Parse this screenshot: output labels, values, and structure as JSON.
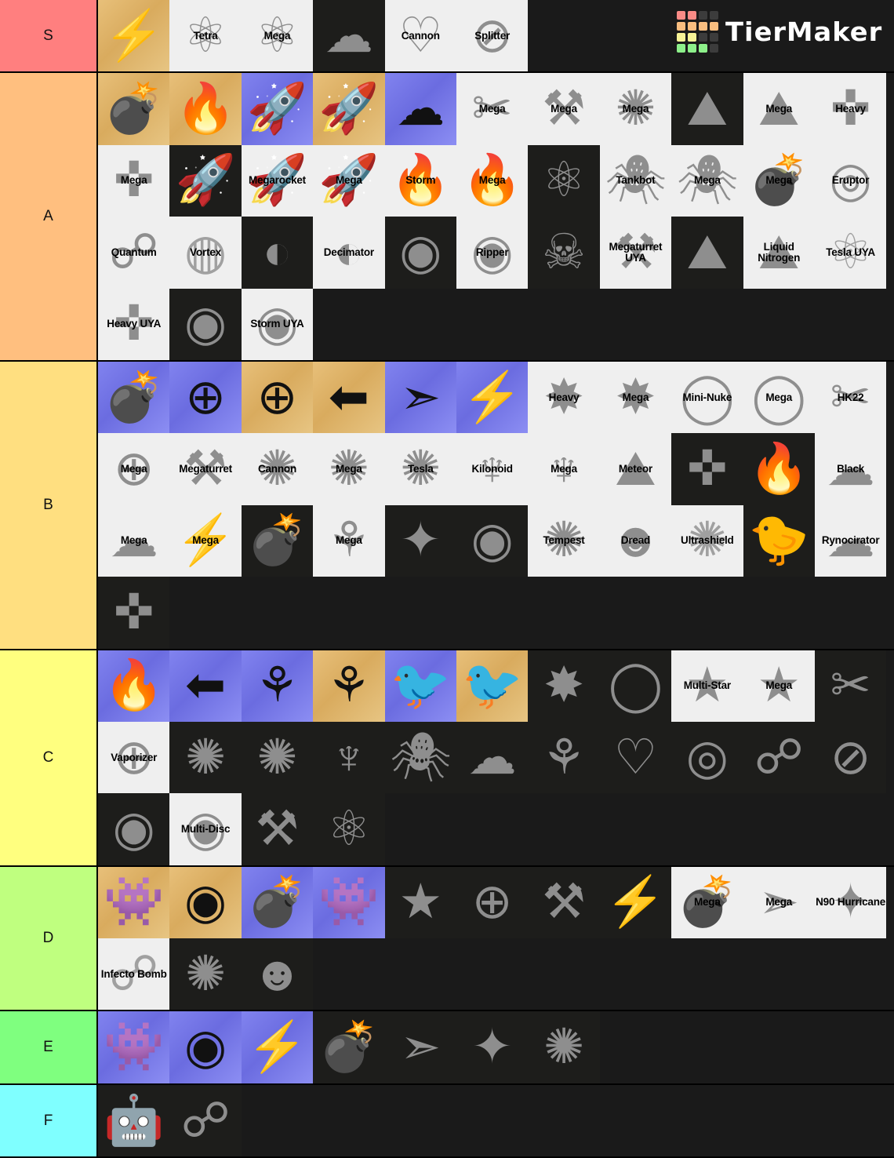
{
  "app": {
    "name": "TierMaker",
    "logo_colors": [
      "#f98b86",
      "#f98b86",
      "#3c3c3c",
      "#3c3c3c",
      "#f8bd7f",
      "#f8bd7f",
      "#f8bd7f",
      "#f8bd7f",
      "#f7f396",
      "#f7f396",
      "#3c3c3c",
      "#3c3c3c",
      "#8df08a",
      "#8df08a",
      "#8df08a",
      "#3c3c3c"
    ]
  },
  "tiers": [
    {
      "label": "S",
      "color": "#ff7f7f",
      "items": [
        {
          "label": "",
          "bg": "gold",
          "ink": "black",
          "glyph": "⚡"
        },
        {
          "label": "Tetra",
          "bg": "white",
          "ink": "gray",
          "glyph": "⚛"
        },
        {
          "label": "Mega",
          "bg": "white",
          "ink": "gray",
          "glyph": "⚛"
        },
        {
          "label": "",
          "bg": "dark",
          "ink": "gray",
          "glyph": "☁"
        },
        {
          "label": "Cannon",
          "bg": "white",
          "ink": "gray",
          "glyph": "♡"
        },
        {
          "label": "Splitter",
          "bg": "white",
          "ink": "gray",
          "glyph": "⊘"
        }
      ]
    },
    {
      "label": "A",
      "color": "#ffbf7f",
      "items": [
        {
          "label": "",
          "bg": "gold",
          "ink": "black",
          "glyph": "💣"
        },
        {
          "label": "",
          "bg": "gold",
          "ink": "black",
          "glyph": "🔥"
        },
        {
          "label": "",
          "bg": "blue",
          "ink": "black",
          "glyph": "🚀"
        },
        {
          "label": "",
          "bg": "gold",
          "ink": "black",
          "glyph": "🚀"
        },
        {
          "label": "",
          "bg": "blue",
          "ink": "black",
          "glyph": "☁"
        },
        {
          "label": "Mega",
          "bg": "white",
          "ink": "gray",
          "glyph": "✂"
        },
        {
          "label": "Mega",
          "bg": "white",
          "ink": "gray",
          "glyph": "⚒"
        },
        {
          "label": "Mega",
          "bg": "white",
          "ink": "gray",
          "glyph": "✺"
        },
        {
          "label": "",
          "bg": "dark",
          "ink": "gray",
          "glyph": "⛰"
        },
        {
          "label": "Mega",
          "bg": "white",
          "ink": "gray",
          "glyph": "⛰"
        },
        {
          "label": "Heavy",
          "bg": "white",
          "ink": "gray",
          "glyph": "✜"
        },
        {
          "label": "Mega",
          "bg": "white",
          "ink": "gray",
          "glyph": "✜"
        },
        {
          "label": "",
          "bg": "dark",
          "ink": "gray",
          "glyph": "🚀"
        },
        {
          "label": "Megarocket",
          "bg": "white",
          "ink": "gray",
          "glyph": "🚀"
        },
        {
          "label": "Mega",
          "bg": "white",
          "ink": "gray",
          "glyph": "🚀"
        },
        {
          "label": "Storm",
          "bg": "white",
          "ink": "gray",
          "glyph": "🔥"
        },
        {
          "label": "Mega",
          "bg": "white",
          "ink": "gray",
          "glyph": "🔥"
        },
        {
          "label": "",
          "bg": "dark",
          "ink": "gray",
          "glyph": "⚛"
        },
        {
          "label": "Tankbot",
          "bg": "white",
          "ink": "gray",
          "glyph": "🕷"
        },
        {
          "label": "Mega",
          "bg": "white",
          "ink": "gray",
          "glyph": "🕷"
        },
        {
          "label": "Mega",
          "bg": "white",
          "ink": "gray",
          "glyph": "💣"
        },
        {
          "label": "Eruptor",
          "bg": "white",
          "ink": "gray",
          "glyph": "◎"
        },
        {
          "label": "Quantum",
          "bg": "white",
          "ink": "gray",
          "glyph": "☍"
        },
        {
          "label": "Vortex",
          "bg": "white",
          "ink": "gray2",
          "glyph": "◍"
        },
        {
          "label": "",
          "bg": "dark",
          "ink": "gray",
          "glyph": "◐"
        },
        {
          "label": "Decimator",
          "bg": "white",
          "ink": "gray",
          "glyph": "◐"
        },
        {
          "label": "",
          "bg": "dark",
          "ink": "gray",
          "glyph": "◉"
        },
        {
          "label": "Ripper",
          "bg": "white",
          "ink": "gray",
          "glyph": "◉"
        },
        {
          "label": "",
          "bg": "dark",
          "ink": "gray",
          "glyph": "☠"
        },
        {
          "label": "Megaturret UYA",
          "bg": "white",
          "ink": "gray",
          "glyph": "⚒"
        },
        {
          "label": "",
          "bg": "dark",
          "ink": "gray",
          "glyph": "⛰"
        },
        {
          "label": "Liquid Nitrogen",
          "bg": "white",
          "ink": "gray",
          "glyph": "⛰"
        },
        {
          "label": "Tesla UYA",
          "bg": "white",
          "ink": "gray2",
          "glyph": "⚛"
        },
        {
          "label": "Heavy UYA",
          "bg": "white",
          "ink": "gray",
          "glyph": "✜"
        },
        {
          "label": "",
          "bg": "dark",
          "ink": "gray",
          "glyph": "◉"
        },
        {
          "label": "Storm UYA",
          "bg": "white",
          "ink": "gray",
          "glyph": "◉"
        }
      ]
    },
    {
      "label": "B",
      "color": "#ffdf80",
      "items": [
        {
          "label": "",
          "bg": "blue",
          "ink": "black",
          "glyph": "💣"
        },
        {
          "label": "",
          "bg": "blue",
          "ink": "black",
          "glyph": "⊕"
        },
        {
          "label": "",
          "bg": "gold",
          "ink": "black",
          "glyph": "⊕"
        },
        {
          "label": "",
          "bg": "gold",
          "ink": "black",
          "glyph": "⬅"
        },
        {
          "label": "",
          "bg": "blue",
          "ink": "black",
          "glyph": "➣"
        },
        {
          "label": "",
          "bg": "blue",
          "ink": "black",
          "glyph": "⚡"
        },
        {
          "label": "Heavy",
          "bg": "white",
          "ink": "gray",
          "glyph": "✸"
        },
        {
          "label": "Mega",
          "bg": "white",
          "ink": "gray",
          "glyph": "✸"
        },
        {
          "label": "Mini-Nuke",
          "bg": "white",
          "ink": "gray",
          "glyph": "◯"
        },
        {
          "label": "Mega",
          "bg": "white",
          "ink": "gray",
          "glyph": "◯"
        },
        {
          "label": "HK22",
          "bg": "white",
          "ink": "gray",
          "glyph": "✂"
        },
        {
          "label": "Mega",
          "bg": "white",
          "ink": "gray",
          "glyph": "⊕"
        },
        {
          "label": "Megaturret",
          "bg": "white",
          "ink": "gray",
          "glyph": "⚒"
        },
        {
          "label": "Cannon",
          "bg": "white",
          "ink": "gray",
          "glyph": "✺"
        },
        {
          "label": "Mega",
          "bg": "white",
          "ink": "gray",
          "glyph": "✺"
        },
        {
          "label": "Tesla",
          "bg": "white",
          "ink": "gray",
          "glyph": "✺"
        },
        {
          "label": "Kilonoid",
          "bg": "white",
          "ink": "gray",
          "glyph": "♆"
        },
        {
          "label": "Mega",
          "bg": "white",
          "ink": "gray",
          "glyph": "♆"
        },
        {
          "label": "Meteor",
          "bg": "white",
          "ink": "gray",
          "glyph": "⛰"
        },
        {
          "label": "",
          "bg": "dark",
          "ink": "gray",
          "glyph": "✜"
        },
        {
          "label": "",
          "bg": "dark",
          "ink": "gray",
          "glyph": "🔥"
        },
        {
          "label": "Black",
          "bg": "white",
          "ink": "gray",
          "glyph": "☁"
        },
        {
          "label": "Mega",
          "bg": "white",
          "ink": "gray",
          "glyph": "☁"
        },
        {
          "label": "Mega",
          "bg": "white",
          "ink": "gray",
          "glyph": "⚡"
        },
        {
          "label": "",
          "bg": "dark",
          "ink": "gray",
          "glyph": "💣"
        },
        {
          "label": "Mega",
          "bg": "white",
          "ink": "gray",
          "glyph": "⚘"
        },
        {
          "label": "",
          "bg": "dark",
          "ink": "gray",
          "glyph": "✦"
        },
        {
          "label": "",
          "bg": "dark",
          "ink": "gray",
          "glyph": "◉"
        },
        {
          "label": "Tempest",
          "bg": "white",
          "ink": "gray",
          "glyph": "✺"
        },
        {
          "label": "Dread",
          "bg": "white",
          "ink": "gray",
          "glyph": "☻"
        },
        {
          "label": "Ultrashield",
          "bg": "white",
          "ink": "gray2",
          "glyph": "✺"
        },
        {
          "label": "",
          "bg": "dark",
          "ink": "gray",
          "glyph": "🐤"
        },
        {
          "label": "Rynocirator",
          "bg": "white",
          "ink": "gray",
          "glyph": "☁"
        },
        {
          "label": "",
          "bg": "dark",
          "ink": "gray",
          "glyph": "✜"
        }
      ]
    },
    {
      "label": "C",
      "color": "#ffff7f",
      "items": [
        {
          "label": "",
          "bg": "blue",
          "ink": "black",
          "glyph": "🔥"
        },
        {
          "label": "",
          "bg": "blue",
          "ink": "black",
          "glyph": "⬅"
        },
        {
          "label": "",
          "bg": "blue",
          "ink": "black",
          "glyph": "⚘"
        },
        {
          "label": "",
          "bg": "gold",
          "ink": "black",
          "glyph": "⚘"
        },
        {
          "label": "",
          "bg": "blue",
          "ink": "black",
          "glyph": "🐦"
        },
        {
          "label": "",
          "bg": "gold",
          "ink": "black",
          "glyph": "🐦"
        },
        {
          "label": "",
          "bg": "dark",
          "ink": "gray",
          "glyph": "✸"
        },
        {
          "label": "",
          "bg": "dark",
          "ink": "gray",
          "glyph": "◯"
        },
        {
          "label": "Multi-Star",
          "bg": "white",
          "ink": "gray",
          "glyph": "★"
        },
        {
          "label": "Mega",
          "bg": "white",
          "ink": "gray",
          "glyph": "★"
        },
        {
          "label": "",
          "bg": "dark",
          "ink": "gray",
          "glyph": "✂"
        },
        {
          "label": "Vaporizer",
          "bg": "white",
          "ink": "gray",
          "glyph": "⊕"
        },
        {
          "label": "",
          "bg": "dark",
          "ink": "gray",
          "glyph": "✺"
        },
        {
          "label": "",
          "bg": "dark",
          "ink": "gray",
          "glyph": "✺"
        },
        {
          "label": "",
          "bg": "dark",
          "ink": "gray",
          "glyph": "♆"
        },
        {
          "label": "",
          "bg": "dark",
          "ink": "gray",
          "glyph": "🕷"
        },
        {
          "label": "",
          "bg": "dark",
          "ink": "gray",
          "glyph": "☁"
        },
        {
          "label": "",
          "bg": "dark",
          "ink": "gray",
          "glyph": "⚘"
        },
        {
          "label": "",
          "bg": "dark",
          "ink": "gray",
          "glyph": "♡"
        },
        {
          "label": "",
          "bg": "dark",
          "ink": "gray",
          "glyph": "◎"
        },
        {
          "label": "",
          "bg": "dark",
          "ink": "gray",
          "glyph": "☍"
        },
        {
          "label": "",
          "bg": "dark",
          "ink": "gray",
          "glyph": "⊘"
        },
        {
          "label": "",
          "bg": "dark",
          "ink": "gray",
          "glyph": "◉"
        },
        {
          "label": "Multi-Disc",
          "bg": "white",
          "ink": "gray",
          "glyph": "◉"
        },
        {
          "label": "",
          "bg": "dark",
          "ink": "gray",
          "glyph": "⚒"
        },
        {
          "label": "",
          "bg": "dark",
          "ink": "gray",
          "glyph": "⚛"
        }
      ]
    },
    {
      "label": "D",
      "color": "#bfff7f",
      "items": [
        {
          "label": "",
          "bg": "gold",
          "ink": "black",
          "glyph": "👾"
        },
        {
          "label": "",
          "bg": "gold",
          "ink": "black",
          "glyph": "◉"
        },
        {
          "label": "",
          "bg": "blue",
          "ink": "black",
          "glyph": "💣"
        },
        {
          "label": "",
          "bg": "blue",
          "ink": "black",
          "glyph": "👾"
        },
        {
          "label": "",
          "bg": "dark",
          "ink": "gray",
          "glyph": "★"
        },
        {
          "label": "",
          "bg": "dark",
          "ink": "gray",
          "glyph": "⊕"
        },
        {
          "label": "",
          "bg": "dark",
          "ink": "gray",
          "glyph": "⚒"
        },
        {
          "label": "",
          "bg": "dark",
          "ink": "gray",
          "glyph": "⚡"
        },
        {
          "label": "Mega",
          "bg": "white",
          "ink": "gray",
          "glyph": "💣"
        },
        {
          "label": "Mega",
          "bg": "white",
          "ink": "gray",
          "glyph": "➣"
        },
        {
          "label": "N90 Hurricane",
          "bg": "white",
          "ink": "gray",
          "glyph": "✦"
        },
        {
          "label": "Infecto Bomb",
          "bg": "white",
          "ink": "gray2",
          "glyph": "☍"
        },
        {
          "label": "",
          "bg": "dark",
          "ink": "gray",
          "glyph": "✺"
        },
        {
          "label": "",
          "bg": "dark",
          "ink": "gray",
          "glyph": "☻"
        }
      ]
    },
    {
      "label": "E",
      "color": "#7fff7f",
      "items": [
        {
          "label": "",
          "bg": "blue",
          "ink": "black",
          "glyph": "👾"
        },
        {
          "label": "",
          "bg": "blue",
          "ink": "black",
          "glyph": "◉"
        },
        {
          "label": "",
          "bg": "blue",
          "ink": "black",
          "glyph": "⚡"
        },
        {
          "label": "",
          "bg": "dark",
          "ink": "gray",
          "glyph": "💣"
        },
        {
          "label": "",
          "bg": "dark",
          "ink": "gray",
          "glyph": "➣"
        },
        {
          "label": "",
          "bg": "dark",
          "ink": "gray",
          "glyph": "✦"
        },
        {
          "label": "",
          "bg": "dark",
          "ink": "gray",
          "glyph": "✺"
        }
      ]
    },
    {
      "label": "F",
      "color": "#7fffff",
      "items": [
        {
          "label": "",
          "bg": "dark",
          "ink": "gray",
          "glyph": "🤖"
        },
        {
          "label": "",
          "bg": "dark",
          "ink": "gray",
          "glyph": "☍"
        }
      ]
    }
  ]
}
